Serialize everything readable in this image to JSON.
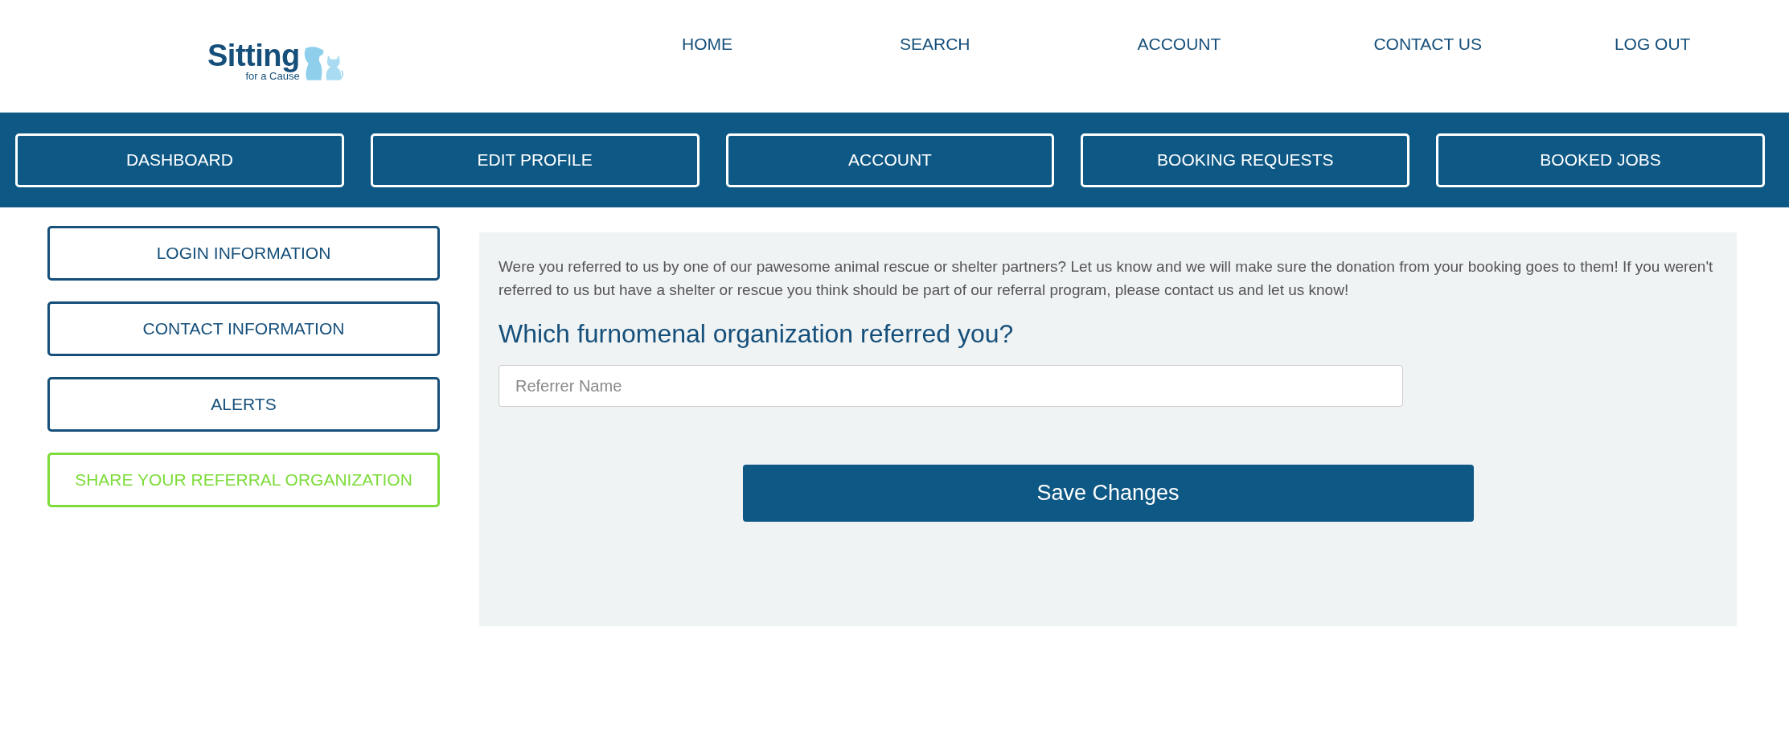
{
  "logo": {
    "title": "Sitting",
    "subtitle": "for a Cause"
  },
  "top_nav": [
    "HOME",
    "SEARCH",
    "ACCOUNT",
    "CONTACT US",
    "LOG OUT"
  ],
  "tabs": [
    {
      "label": "DASHBOARD",
      "selected": false
    },
    {
      "label": "EDIT PROFILE",
      "selected": false
    },
    {
      "label": "ACCOUNT",
      "selected": false
    },
    {
      "label": "BOOKING REQUESTS",
      "selected": false
    },
    {
      "label": "BOOKED JOBS",
      "selected": false
    }
  ],
  "sidebar": {
    "items": [
      {
        "label": "LOGIN INFORMATION",
        "selected": false
      },
      {
        "label": "CONTACT INFORMATION",
        "selected": false
      },
      {
        "label": "ALERTS",
        "selected": false
      },
      {
        "label": "SHARE YOUR REFERRAL ORGANIZATION",
        "selected": true
      }
    ]
  },
  "panel": {
    "intro": "Were you referred to us by one of our pawesome animal rescue or shelter partners? Let us know and we will make sure the donation from your booking goes to them! If you weren't referred to us but have a shelter or rescue you think should be part of our referral program, please contact us and let us know!",
    "heading": "Which furnomenal organization referred you?",
    "field": {
      "placeholder": "Referrer Name"
    },
    "button": "Save Changes"
  }
}
